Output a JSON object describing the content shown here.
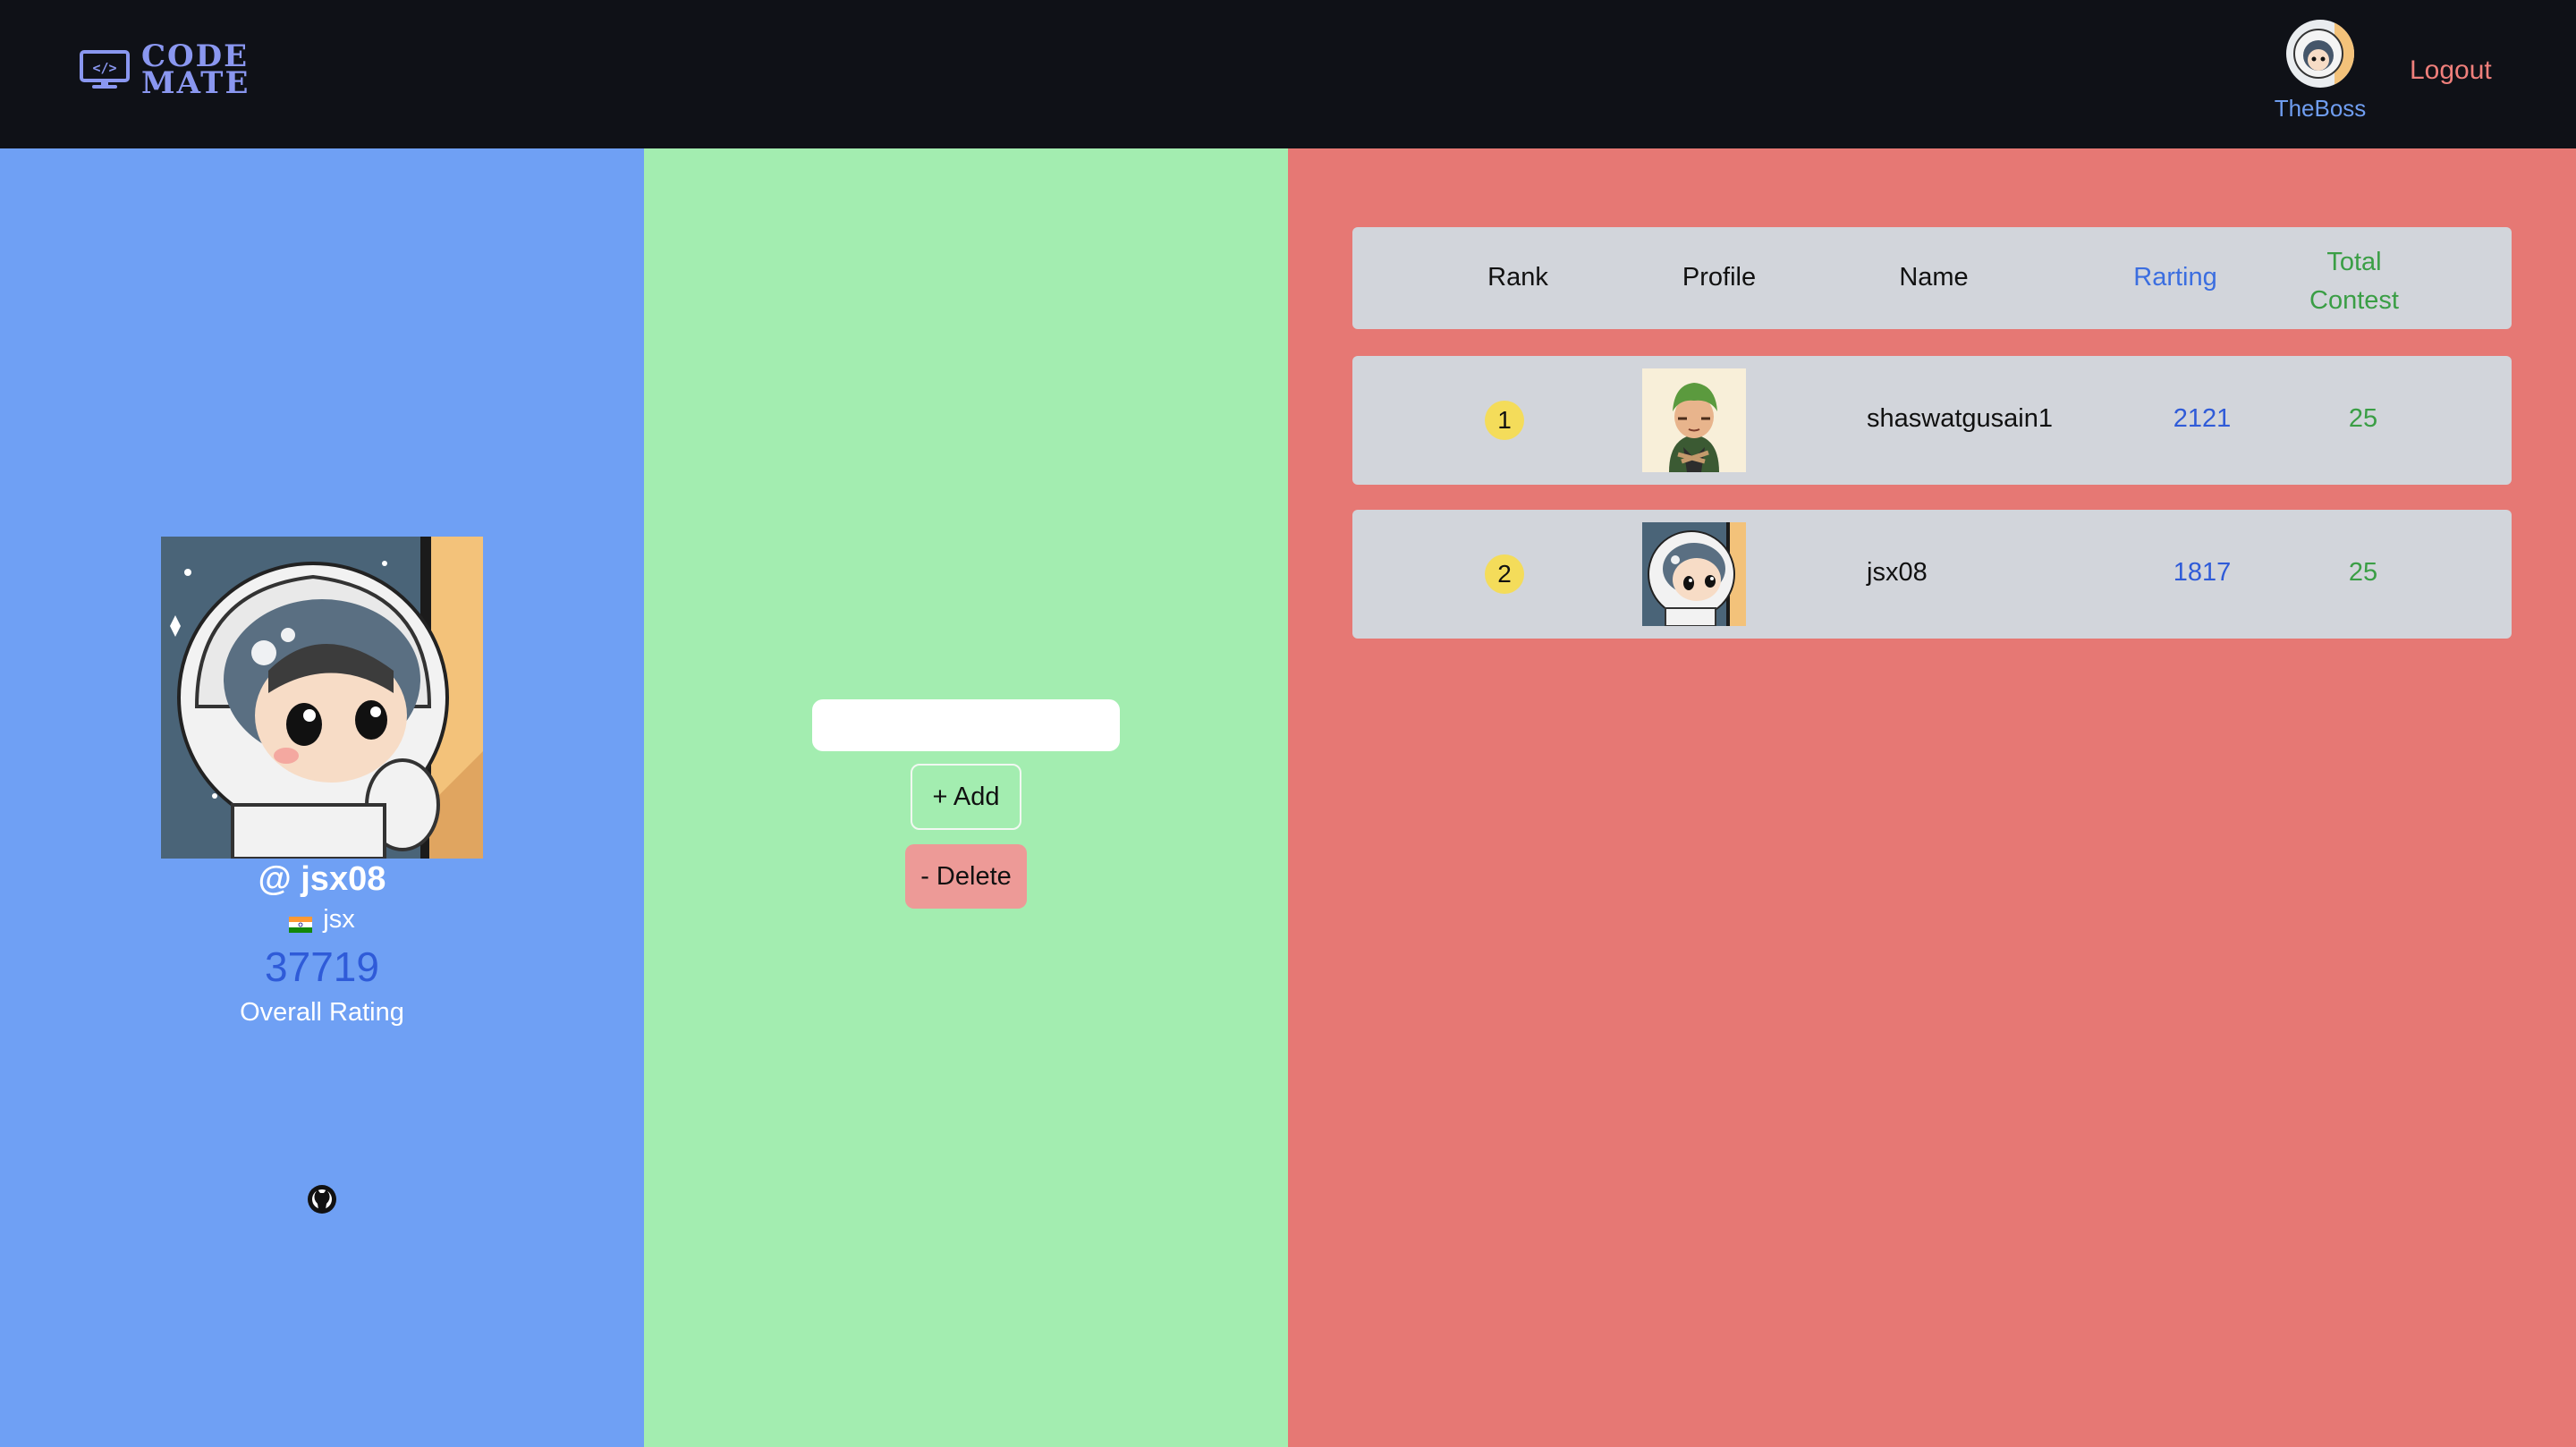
{
  "navbar": {
    "logo_line1": "CODE",
    "logo_line2": "MATE",
    "logo_icon": "monitor-code-icon",
    "username": "TheBoss",
    "logout_label": "Logout"
  },
  "profile": {
    "handle": "@ jsx08",
    "country_flag": "india-flag-icon",
    "display_name": "jsx",
    "rating": "37719",
    "rating_label": "Overall Rating",
    "social_icon": "github-icon"
  },
  "manage": {
    "input_value": "",
    "input_placeholder": "",
    "add_label": "+ Add",
    "delete_label": "- Delete"
  },
  "leaderboard": {
    "headers": {
      "rank": "Rank",
      "profile": "Profile",
      "name": "Name",
      "rating": "Rarting",
      "contest_line1": "Total",
      "contest_line2": "Contest"
    },
    "rows": [
      {
        "rank": "1",
        "name": "shaswatgusain1",
        "rating": "2121",
        "contests": "25",
        "avatar": "green-hair-character-avatar"
      },
      {
        "rank": "2",
        "name": "jsx08",
        "rating": "1817",
        "contests": "25",
        "avatar": "astronaut-avatar"
      }
    ]
  },
  "colors": {
    "navbar_bg": "#0f1117",
    "left_panel": "#6fa0f4",
    "middle_panel": "#a3edb0",
    "right_panel": "#e67874",
    "rating_blue": "#2f5bd8",
    "contest_green": "#3a9e45",
    "logout_red": "#ef7f7b",
    "rank_badge": "#f4dc5a"
  }
}
